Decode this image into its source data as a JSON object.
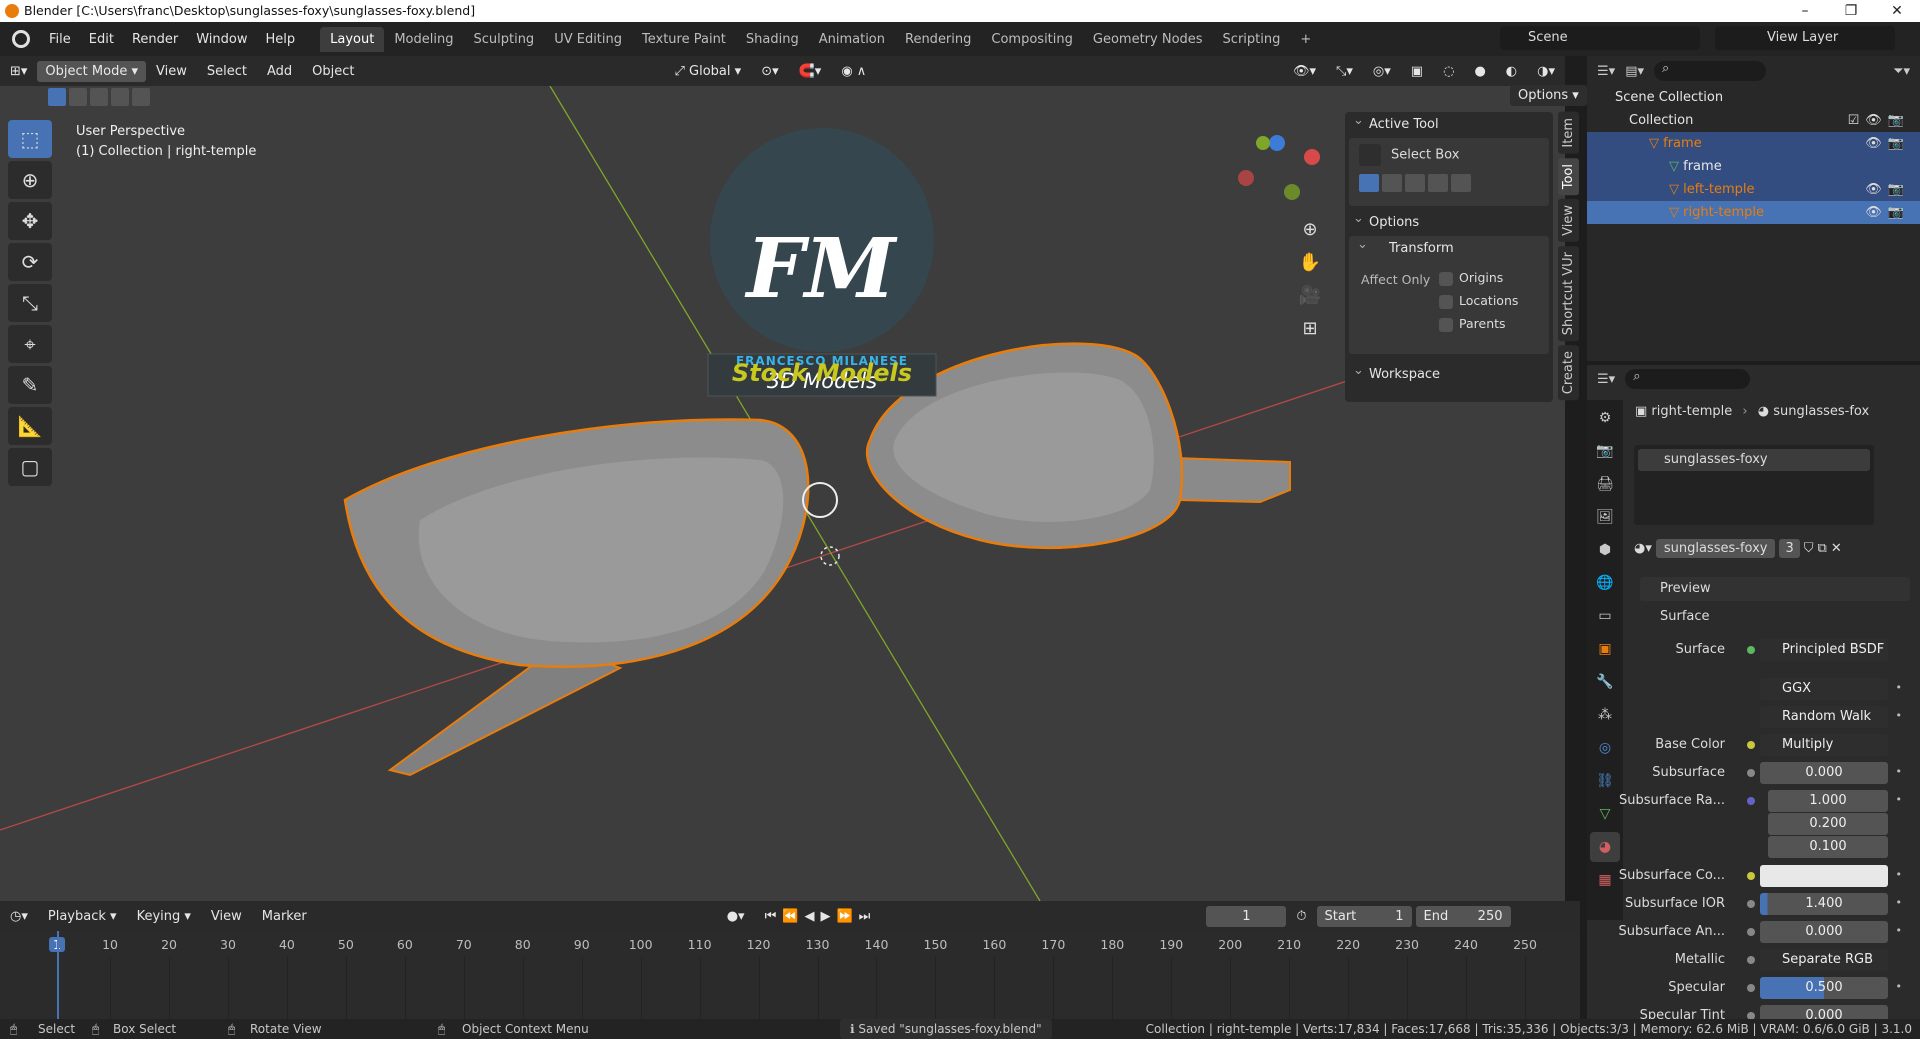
{
  "window": {
    "title": "Blender [C:\\Users\\franc\\Desktop\\sunglasses-foxy\\sunglasses-foxy.blend]"
  },
  "menus": [
    "File",
    "Edit",
    "Render",
    "Window",
    "Help"
  ],
  "workspaces": [
    "Layout",
    "Modeling",
    "Sculpting",
    "UV Editing",
    "Texture Paint",
    "Shading",
    "Animation",
    "Rendering",
    "Compositing",
    "Geometry Nodes",
    "Scripting"
  ],
  "scene": "Scene",
  "view_layer": "View Layer",
  "viewport_header": {
    "mode": "Object Mode",
    "menus": [
      "View",
      "Select",
      "Add",
      "Object"
    ],
    "orientation": "Global",
    "options": "Options"
  },
  "viewport": {
    "perspective": "User Perspective",
    "context": "(1) Collection | right-temple"
  },
  "watermark": {
    "initials": "FM",
    "author": "FRANCESCO MILANESE",
    "subtitle": "3D Models",
    "banner": "Stock Models"
  },
  "n_panel": {
    "active_tool": "Active Tool",
    "select_box": "Select Box",
    "options": "Options",
    "transform": "Transform",
    "affect_only": "Affect Only",
    "origins": "Origins",
    "locations": "Locations",
    "parents": "Parents",
    "workspace": "Workspace",
    "tabs": [
      "Item",
      "Tool",
      "View",
      "Shortcut VUr",
      "Create"
    ]
  },
  "outliner": {
    "scene_collection": "Scene Collection",
    "collection": "Collection",
    "items": [
      "frame",
      "frame",
      "left-temple",
      "right-temple"
    ]
  },
  "properties": {
    "breadcrumb_object": "right-temple",
    "breadcrumb_material": "sunglasses-fox",
    "material_slot": "sunglasses-foxy",
    "material_name": "sunglasses-foxy",
    "users": "3",
    "preview": "Preview",
    "surface_section": "Surface",
    "rows": [
      {
        "label": "Surface",
        "value": "Principled BSDF"
      },
      {
        "label": "",
        "value": "GGX"
      },
      {
        "label": "",
        "value": "Random Walk"
      },
      {
        "label": "Base Color",
        "value": "Multiply"
      },
      {
        "label": "Subsurface",
        "value": "0.000"
      },
      {
        "label": "Subsurface Ra...",
        "value": "1.000"
      },
      {
        "label": "",
        "value": "0.200"
      },
      {
        "label": "",
        "value": "0.100"
      },
      {
        "label": "Subsurface Co...",
        "value": ""
      },
      {
        "label": "Subsurface IOR",
        "value": "1.400"
      },
      {
        "label": "Subsurface An...",
        "value": "0.000"
      },
      {
        "label": "Metallic",
        "value": "Separate RGB"
      },
      {
        "label": "Specular",
        "value": "0.500"
      },
      {
        "label": "Specular Tint",
        "value": "0.000"
      }
    ]
  },
  "timeline": {
    "menus": [
      "Playback",
      "Keying",
      "View",
      "Marker"
    ],
    "current_frame": "1",
    "start_label": "Start",
    "start": "1",
    "end_label": "End",
    "end": "250",
    "ticks": [
      "1",
      "10",
      "20",
      "30",
      "40",
      "50",
      "60",
      "70",
      "80",
      "90",
      "100",
      "110",
      "120",
      "130",
      "140",
      "150",
      "160",
      "170",
      "180",
      "190",
      "200",
      "210",
      "220",
      "230",
      "240",
      "250"
    ]
  },
  "statusbar": {
    "select": "Select",
    "box_select": "Box Select",
    "rotate_view": "Rotate View",
    "context_menu": "Object Context Menu",
    "message": "Saved \"sunglasses-foxy.blend\"",
    "stats": "Collection | right-temple | Verts:17,834 | Faces:17,668 | Tris:35,336 | Objects:3/3 | Memory: 62.6 MiB | VRAM: 0.6/6.0 GiB | 3.1.0"
  },
  "colors": {
    "accent": "#4772b3",
    "selection": "#e87d0d",
    "x_axis": "#d84a4a",
    "y_axis": "#7fa62a"
  }
}
